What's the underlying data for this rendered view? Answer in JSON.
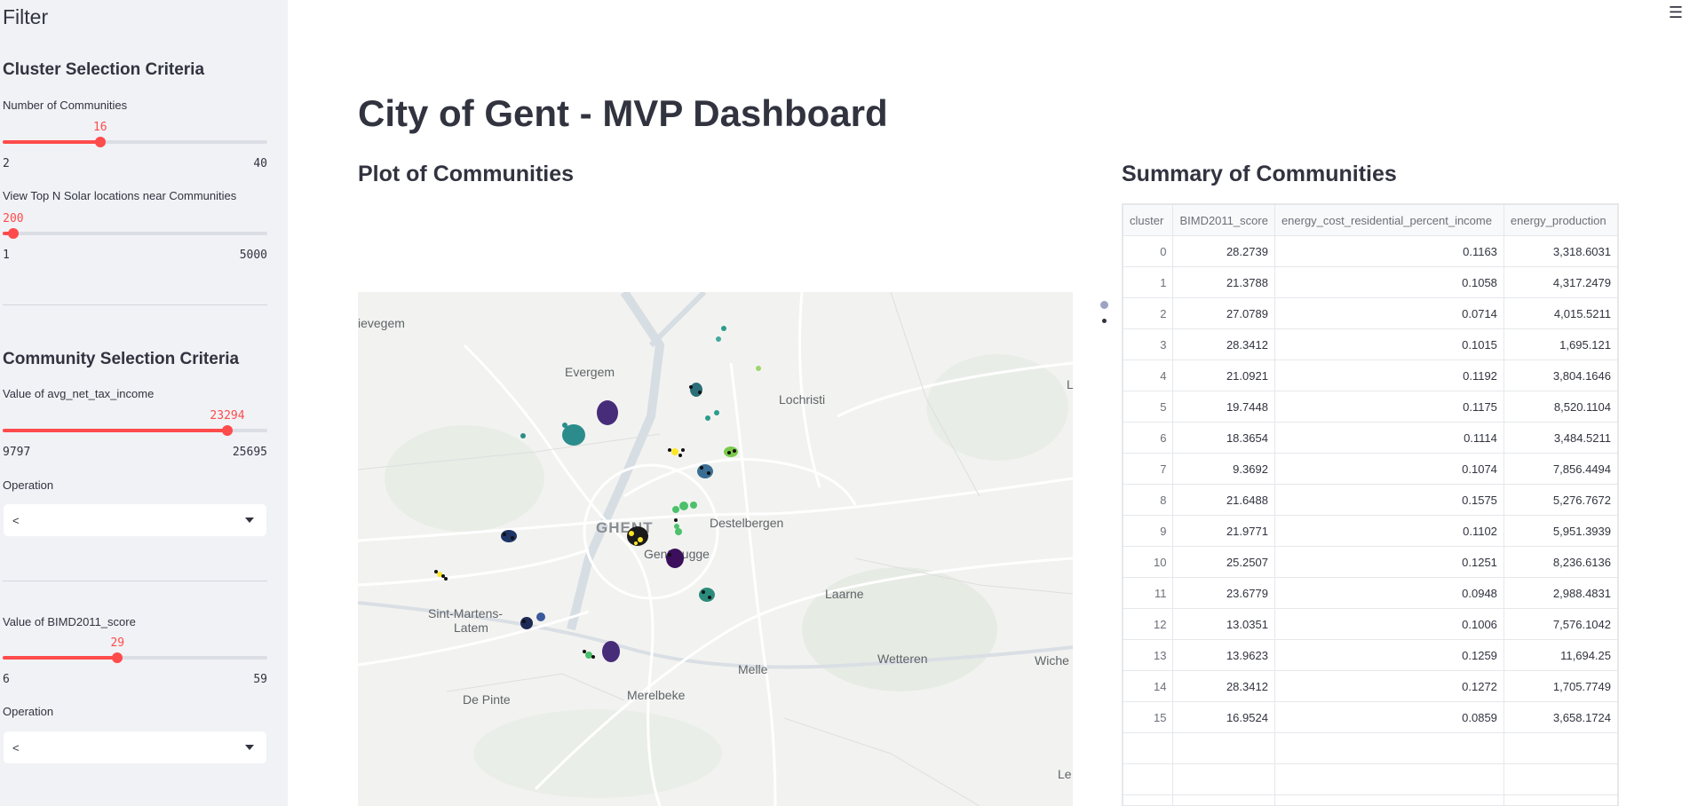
{
  "sidebar": {
    "title": "Filter",
    "cluster_header": "Cluster Selection Criteria",
    "communities_slider": {
      "label": "Number of Communities",
      "value": 16,
      "min": 2,
      "max": 40,
      "value_text": "16",
      "min_text": "2",
      "max_text": "40"
    },
    "solar_slider": {
      "label": "View Top N Solar locations near Communities",
      "value": 200,
      "min": 1,
      "max": 5000,
      "value_text": "200",
      "min_text": "1",
      "max_text": "5000"
    },
    "community_header": "Community Selection Criteria",
    "income_slider": {
      "label": "Value of avg_net_tax_income",
      "value": 23294,
      "min": 9797,
      "max": 25695,
      "value_text": "23294",
      "min_text": "9797",
      "max_text": "25695"
    },
    "operation1": {
      "label": "Operation",
      "value": "<"
    },
    "bimd_slider": {
      "label": "Value of BIMD2011_score",
      "value": 29,
      "min": 6,
      "max": 59,
      "value_text": "29",
      "min_text": "6",
      "max_text": "59"
    },
    "operation2": {
      "label": "Operation",
      "value": "<"
    }
  },
  "main": {
    "menu_icon": "hamburger-menu-icon",
    "title": "City of Gent - MVP Dashboard",
    "plot_header": "Plot of Communities",
    "summary_header": "Summary of Communities"
  },
  "map_labels": {
    "ievegem": "ievegem",
    "evergem": "Evergem",
    "lochristi": "Lochristi",
    "ghent": "GHENT",
    "destelbergen": "Destelbergen",
    "gentbrugge": "Gentbrugge",
    "sint_martens": "Sint-Martens-",
    "latem": "Latem",
    "laarne": "Laarne",
    "wetteren": "Wetteren",
    "wiche": "Wiche",
    "melle": "Melle",
    "de_pinte": "De Pinte",
    "merelbeke": "Merelbeke",
    "l_edge": "L",
    "le_edge": "Le"
  },
  "colors": {
    "accent": "#ff4b4b",
    "sidebar_bg": "#f0f2f6",
    "text": "#31333f"
  },
  "table": {
    "columns": [
      "cluster",
      "BIMD2011_score",
      "energy_cost_residential_percent_income",
      "energy_production"
    ],
    "rows": [
      [
        "0",
        "28.2739",
        "0.1163",
        "3,318.6031"
      ],
      [
        "1",
        "21.3788",
        "0.1058",
        "4,317.2479"
      ],
      [
        "2",
        "27.0789",
        "0.0714",
        "4,015.5211"
      ],
      [
        "3",
        "28.3412",
        "0.1015",
        "1,695.121"
      ],
      [
        "4",
        "21.0921",
        "0.1192",
        "3,804.1646"
      ],
      [
        "5",
        "19.7448",
        "0.1175",
        "8,520.1104"
      ],
      [
        "6",
        "18.3654",
        "0.1114",
        "3,484.5211"
      ],
      [
        "7",
        "9.3692",
        "0.1074",
        "7,856.4494"
      ],
      [
        "8",
        "21.6488",
        "0.1575",
        "5,276.7672"
      ],
      [
        "9",
        "21.9771",
        "0.1102",
        "5,951.3939"
      ],
      [
        "10",
        "25.2507",
        "0.1251",
        "8,236.6136"
      ],
      [
        "11",
        "23.6779",
        "0.0948",
        "2,988.4831"
      ],
      [
        "12",
        "13.0351",
        "0.1006",
        "7,576.1042"
      ],
      [
        "13",
        "13.9623",
        "0.1259",
        "11,694.25"
      ],
      [
        "14",
        "28.3412",
        "0.1272",
        "1,705.7749"
      ],
      [
        "15",
        "16.9524",
        "0.0859",
        "3,658.1724"
      ]
    ]
  }
}
